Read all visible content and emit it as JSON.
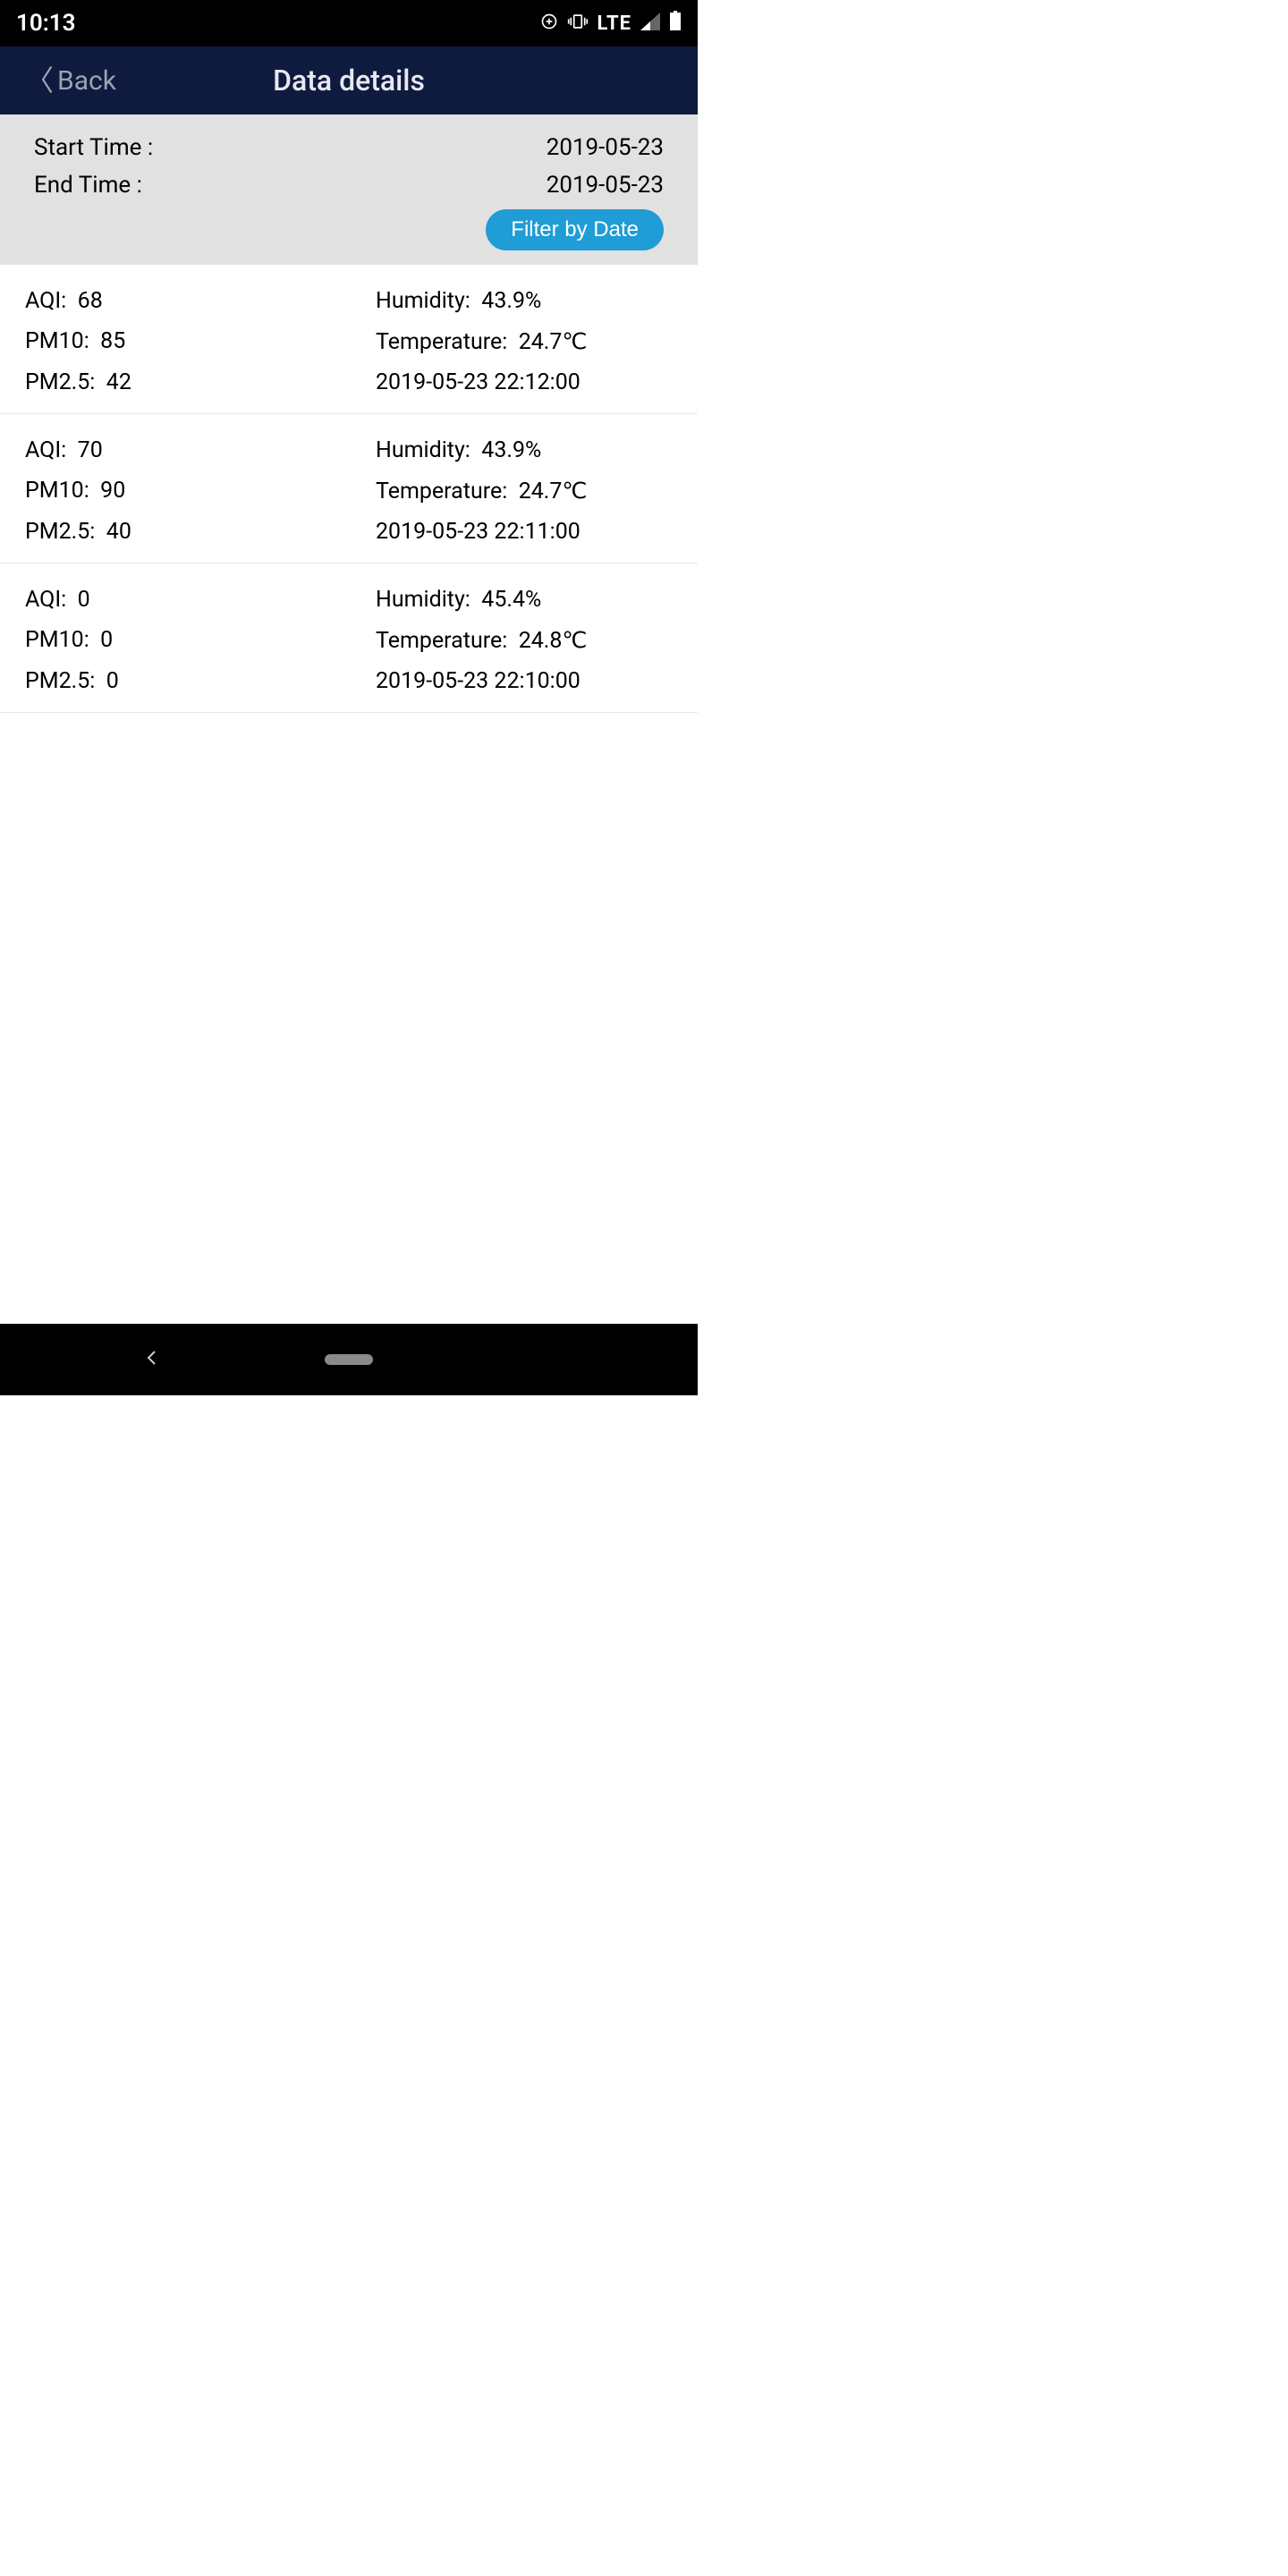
{
  "status": {
    "time": "10:13",
    "network": "LTE"
  },
  "header": {
    "back_label": "Back",
    "title": "Data details"
  },
  "filter": {
    "start_label": "Start Time :",
    "start_value": "2019-05-23",
    "end_label": "End Time :",
    "end_value": "2019-05-23",
    "button_label": "Filter by Date"
  },
  "labels": {
    "aqi": "AQI:",
    "pm10": "PM10:",
    "pm25": "PM2.5:",
    "humidity": "Humidity:",
    "temperature": "Temperature:"
  },
  "records": [
    {
      "aqi": "68",
      "pm10": "85",
      "pm25": "42",
      "humidity": "43.9%",
      "temperature": "24.7℃",
      "timestamp": "2019-05-23 22:12:00"
    },
    {
      "aqi": "70",
      "pm10": "90",
      "pm25": "40",
      "humidity": "43.9%",
      "temperature": "24.7℃",
      "timestamp": "2019-05-23 22:11:00"
    },
    {
      "aqi": "0",
      "pm10": "0",
      "pm25": "0",
      "humidity": "45.4%",
      "temperature": "24.8℃",
      "timestamp": "2019-05-23 22:10:00"
    }
  ]
}
